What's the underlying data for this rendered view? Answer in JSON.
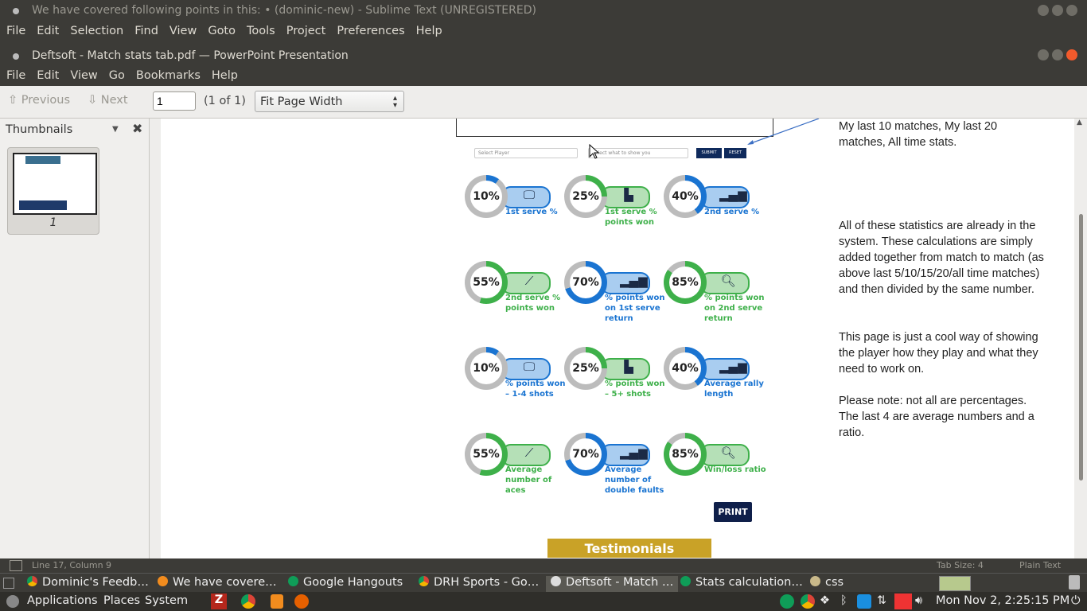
{
  "sublime": {
    "title": "We have covered following points in this: • (dominic-new) - Sublime Text (UNREGISTERED)",
    "menu": [
      "File",
      "Edit",
      "Selection",
      "Find",
      "View",
      "Goto",
      "Tools",
      "Project",
      "Preferences",
      "Help"
    ],
    "status_left": "Line 17, Column 9",
    "status_tabsize": "Tab Size: 4",
    "status_syntax": "Plain Text"
  },
  "pdf": {
    "title": "Deftsoft - Match stats tab.pdf — PowerPoint Presentation",
    "menu": [
      "File",
      "Edit",
      "View",
      "Go",
      "Bookmarks",
      "Help"
    ],
    "toolbar": {
      "previous": "Previous",
      "next": "Next",
      "page_value": "1",
      "page_count": "(1 of 1)",
      "zoom": "Fit Page Width"
    },
    "sidebar": {
      "title": "Thumbnails",
      "thumb_label": "1"
    }
  },
  "slide": {
    "select_player": "Select Player",
    "show_placeholder": "Select what to show you",
    "submit": "SUBMIT",
    "reset": "RESET",
    "stats": [
      {
        "value": "10%",
        "label": "1st serve %",
        "color": "blue",
        "pct": 10,
        "icon": "monitor-chart-icon"
      },
      {
        "value": "25%",
        "label": "1st serve % points won",
        "color": "green",
        "pct": 25,
        "icon": "bar-chart-icon"
      },
      {
        "value": "40%",
        "label": "2nd serve %",
        "color": "blue",
        "pct": 40,
        "icon": "signal-bars-icon"
      },
      {
        "value": "55%",
        "label": "2nd serve % points won",
        "color": "green",
        "pct": 55,
        "icon": "trend-line-icon"
      },
      {
        "value": "70%",
        "label": "% points won on 1st serve return",
        "color": "blue",
        "pct": 70,
        "icon": "signal-bars-icon"
      },
      {
        "value": "85%",
        "label": "% points won on 2nd serve return",
        "color": "green",
        "pct": 85,
        "icon": "magnifier-chart-icon"
      },
      {
        "value": "10%",
        "label": "% points won – 1-4 shots",
        "color": "blue",
        "pct": 10,
        "icon": "monitor-chart-icon"
      },
      {
        "value": "25%",
        "label": "% points won – 5+ shots",
        "color": "green",
        "pct": 25,
        "icon": "bar-chart-icon"
      },
      {
        "value": "40%",
        "label": "Average rally length",
        "color": "blue",
        "pct": 40,
        "icon": "signal-bars-icon"
      },
      {
        "value": "55%",
        "label": "Average number of aces",
        "color": "green",
        "pct": 55,
        "icon": "trend-line-icon"
      },
      {
        "value": "70%",
        "label": "Average number of double faults",
        "color": "blue",
        "pct": 70,
        "icon": "signal-bars-icon"
      },
      {
        "value": "85%",
        "label": "Win/loss ratio",
        "color": "green",
        "pct": 85,
        "icon": "magnifier-chart-icon"
      }
    ],
    "print": "PRINT",
    "testimonials": "Testimonials"
  },
  "notes": {
    "p0": "My last 10 matches, My last 20 matches, All time stats.",
    "p1": "All of these statistics are already in the system. These calculations are simply added together from match to match (as above last 5/10/15/20/all time matches) and then divided by the same number.",
    "p2": "This page is just a cool way of showing the player how they play and what they need to work on.",
    "p3": "Please note: not all are percentages. The last 4 are average numbers and a ratio."
  },
  "taskbar": [
    {
      "label": "Dominic's Feedb…",
      "icon": "chrome-icon"
    },
    {
      "label": "We have covere…",
      "icon": "sublime-icon"
    },
    {
      "label": "Google Hangouts",
      "icon": "hangouts-icon"
    },
    {
      "label": "DRH Sports - Go…",
      "icon": "chrome-icon"
    },
    {
      "label": "Deftsoft - Match …",
      "icon": "document-icon"
    },
    {
      "label": "Stats calculation…",
      "icon": "spreadsheet-icon"
    },
    {
      "label": "css",
      "icon": "folder-icon"
    }
  ],
  "panel": {
    "applications": "Applications",
    "places": "Places",
    "system": "System",
    "clock": "Mon Nov  2,  2:25:15 PM"
  },
  "colors": {
    "blue": "#1a74d1",
    "green": "#3eb04a",
    "pill_blue": "#a9cdf0",
    "pill_green": "#b5e0b7"
  }
}
